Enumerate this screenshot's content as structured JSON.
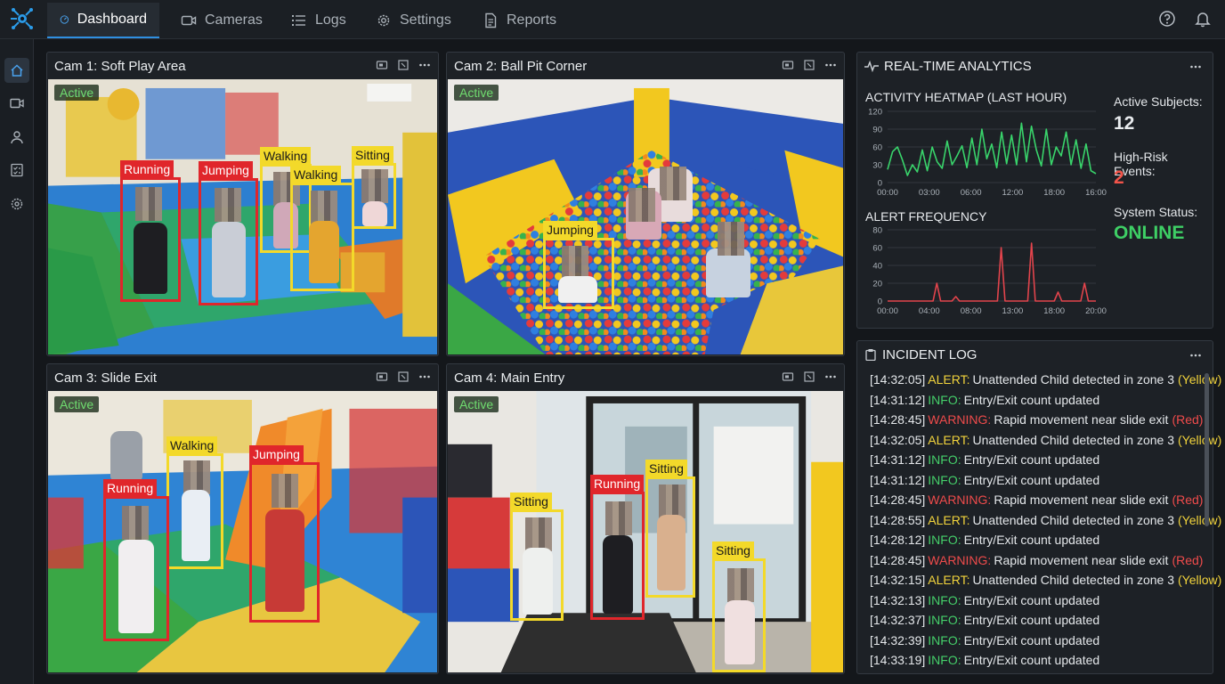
{
  "nav": {
    "tabs": [
      {
        "label": "Dashboard",
        "icon": "gauge-icon",
        "active": true
      },
      {
        "label": "Cameras",
        "icon": "camera-icon",
        "active": false
      },
      {
        "label": "Logs",
        "icon": "list-icon",
        "active": false
      },
      {
        "label": "Settings",
        "icon": "gear-icon",
        "active": false
      },
      {
        "label": "Reports",
        "icon": "document-icon",
        "active": false
      }
    ],
    "right_icons": [
      "help-icon",
      "bell-icon"
    ]
  },
  "sidebar": {
    "items": [
      {
        "icon": "home-icon",
        "active": true
      },
      {
        "icon": "video-icon",
        "active": false
      },
      {
        "icon": "user-icon",
        "active": false
      },
      {
        "icon": "checklist-icon",
        "active": false
      },
      {
        "icon": "gear-icon",
        "active": false
      }
    ]
  },
  "cameras": [
    {
      "title": "Cam 1: Soft Play Area",
      "status": "Active",
      "detections": [
        {
          "label": "Running",
          "severity": "red"
        },
        {
          "label": "Jumping",
          "severity": "red"
        },
        {
          "label": "Walking",
          "severity": "yellow"
        },
        {
          "label": "Walking",
          "severity": "yellow"
        },
        {
          "label": "Sitting",
          "severity": "yellow"
        }
      ]
    },
    {
      "title": "Cam 2: Ball Pit Corner",
      "status": "Active",
      "detections": [
        {
          "label": "Jumping",
          "severity": "yellow"
        }
      ]
    },
    {
      "title": "Cam 3: Slide Exit",
      "status": "Active",
      "detections": [
        {
          "label": "Walking",
          "severity": "yellow"
        },
        {
          "label": "Jumping",
          "severity": "red"
        },
        {
          "label": "Running",
          "severity": "red"
        }
      ]
    },
    {
      "title": "Cam 4: Main Entry",
      "status": "Active",
      "detections": [
        {
          "label": "Sitting",
          "severity": "yellow"
        },
        {
          "label": "Running",
          "severity": "red"
        },
        {
          "label": "Sitting",
          "severity": "yellow"
        },
        {
          "label": "Sitting",
          "severity": "yellow"
        }
      ]
    }
  ],
  "analytics": {
    "title": "REAL-TIME ANALYTICS",
    "heatmap_title": "ACTIVITY HEATMAP (LAST HOUR)",
    "alert_title": "ALERT FREQUENCY",
    "stats": {
      "subjects_label": "Active Subjects:",
      "subjects_value": "12",
      "risk_label": "High-Risk Events:",
      "risk_value": "2",
      "status_label": "System Status:",
      "status_value": "ONLINE"
    },
    "colors": {
      "heatmap_line": "#39d46b",
      "alert_line": "#e2444c",
      "risk_value": "#f2544a",
      "status_value": "#3ecf65"
    }
  },
  "chart_data": [
    {
      "type": "line",
      "title": "ACTIVITY HEATMAP (LAST HOUR)",
      "x_ticks": [
        "00:00",
        "03:00",
        "06:00",
        "12:00",
        "18:00",
        "16:00"
      ],
      "y_ticks": [
        0,
        30,
        60,
        90,
        120
      ],
      "ylim": [
        0,
        120
      ],
      "grid": true,
      "series": [
        {
          "values": [
            22,
            52,
            60,
            38,
            12,
            30,
            18,
            55,
            20,
            60,
            35,
            24,
            70,
            30,
            45,
            62,
            25,
            75,
            30,
            90,
            40,
            65,
            25,
            85,
            32,
            80,
            30,
            100,
            35,
            95,
            55,
            28,
            90,
            30,
            60,
            45,
            85,
            30,
            72,
            24,
            65,
            20,
            15
          ]
        }
      ]
    },
    {
      "type": "line",
      "title": "ALERT FREQUENCY",
      "x_ticks": [
        "00:00",
        "04:00",
        "08:00",
        "13:00",
        "18:00",
        "20:00"
      ],
      "y_ticks": [
        0,
        20,
        40,
        60,
        80
      ],
      "ylim": [
        0,
        80
      ],
      "grid": true,
      "series": [
        {
          "values": [
            0,
            0,
            0,
            0,
            0,
            0,
            0,
            0,
            0,
            0,
            0,
            0,
            0,
            20,
            0,
            0,
            0,
            0,
            5,
            0,
            0,
            0,
            0,
            0,
            0,
            0,
            0,
            0,
            0,
            0,
            60,
            0,
            0,
            0,
            0,
            0,
            0,
            0,
            65,
            0,
            0,
            0,
            0,
            0,
            0,
            10,
            0,
            0,
            0,
            0,
            0,
            0,
            20,
            0,
            0,
            0
          ]
        }
      ]
    }
  ],
  "incident_log": {
    "title": "INCIDENT LOG",
    "rows": [
      {
        "time": "[14:32:05]",
        "level": "ALERT:",
        "message": "Unattended Child detected in zone 3",
        "tag": "(Yellow)",
        "kind": "alert"
      },
      {
        "time": "[14:31:12]",
        "level": "INFO:",
        "message": "Entry/Exit count updated",
        "tag": "",
        "kind": "info"
      },
      {
        "time": "[14:28:45]",
        "level": "WARNING:",
        "message": "Rapid movement near slide exit",
        "tag": "(Red)",
        "kind": "warning"
      },
      {
        "time": "[14:32:05]",
        "level": "ALERT:",
        "message": "Unattended Child detected in zone 3",
        "tag": "(Yellow)",
        "kind": "alert"
      },
      {
        "time": "[14:31:12]",
        "level": "INFO:",
        "message": "Entry/Exit count updated",
        "tag": "",
        "kind": "info"
      },
      {
        "time": "[14:31:12]",
        "level": "INFO:",
        "message": "Entry/Exit count updated",
        "tag": "",
        "kind": "info"
      },
      {
        "time": "[14:28:45]",
        "level": "WARNING:",
        "message": "Rapid movement near slide exit",
        "tag": "(Red)",
        "kind": "warning"
      },
      {
        "time": "[14:28:55]",
        "level": "ALERT:",
        "message": "Unattended Child detected in zone 3",
        "tag": "(Yellow)",
        "kind": "alert"
      },
      {
        "time": "[14:28:12]",
        "level": "INFO:",
        "message": "Entry/Exit count updated",
        "tag": "",
        "kind": "info"
      },
      {
        "time": "[14:28:45]",
        "level": "WARNING:",
        "message": "Rapid movement near slide exit",
        "tag": "(Red)",
        "kind": "warning"
      },
      {
        "time": "[14:32:15]",
        "level": "ALERT:",
        "message": "Unattended Child detected in zone 3",
        "tag": "(Yellow)",
        "kind": "alert"
      },
      {
        "time": "[14:32:13]",
        "level": "INFO:",
        "message": "Entry/Exit count updated",
        "tag": "",
        "kind": "info"
      },
      {
        "time": "[14:32:37]",
        "level": "INFO:",
        "message": "Entry/Exit count updated",
        "tag": "",
        "kind": "info"
      },
      {
        "time": "[14:32:39]",
        "level": "INFO:",
        "message": "Entry/Exit count updated",
        "tag": "",
        "kind": "info"
      },
      {
        "time": "[14:33:19]",
        "level": "INFO:",
        "message": "Entry/Exit count updated",
        "tag": "",
        "kind": "info"
      }
    ],
    "colors": {
      "alert": "#f2d43c",
      "info": "#45cf6a",
      "warning": "#ef4b4b"
    }
  }
}
